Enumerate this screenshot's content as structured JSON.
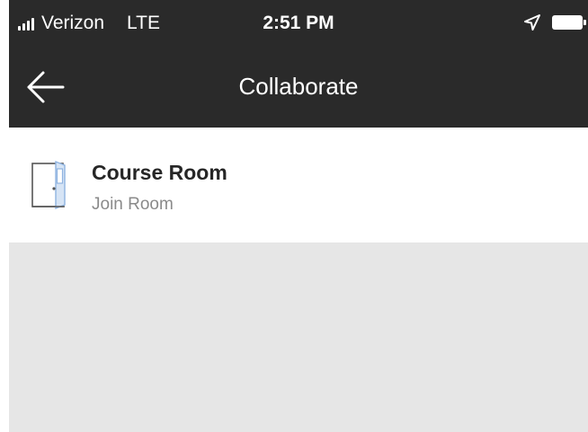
{
  "status_bar": {
    "carrier": "Verizon",
    "network": "LTE",
    "time": "2:51 PM",
    "signal_icon": "signal-bars-icon",
    "location_icon": "location-arrow-icon",
    "battery_icon": "battery-icon",
    "battery_level": 1.0
  },
  "nav": {
    "back_icon": "arrow-left-icon",
    "title": "Collaborate"
  },
  "rooms": [
    {
      "icon": "door-icon",
      "name": "Course Room",
      "subtitle": "Join Room"
    }
  ],
  "colors": {
    "header_bg": "#2a2a2a",
    "header_text": "#ffffff",
    "list_bg": "#ffffff",
    "empty_bg": "#e6e6e6",
    "title_text": "#262626",
    "subtitle_text": "#8a8a8a",
    "door_accent": "#8fb3e0"
  }
}
